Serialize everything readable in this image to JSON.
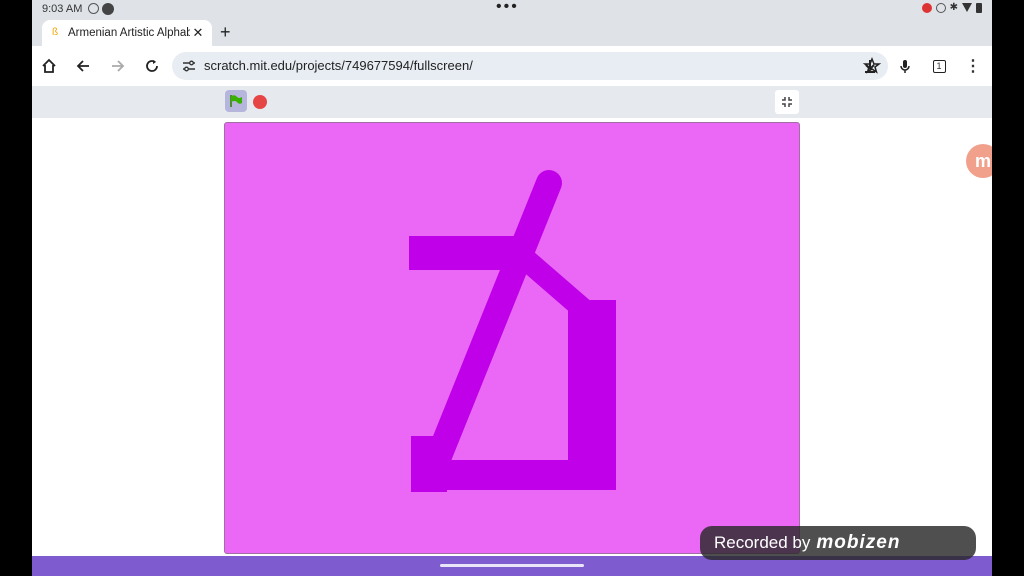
{
  "status": {
    "time": "9:03 AM"
  },
  "tab": {
    "title": "Armenian Artistic Alphabet"
  },
  "address": {
    "url": "scratch.mit.edu/projects/749677594/fullscreen/"
  },
  "stage": {
    "background": "#eb68f7",
    "glyph_color": "#c000e8"
  },
  "watermark": {
    "text": "Recorded by",
    "brand": "mobizen"
  },
  "colors": {
    "bottom_bar": "#7e5ccf",
    "stop": "#e64545",
    "flag": "#38b000"
  },
  "icons": {
    "home": "home-icon",
    "back": "back-arrow-icon",
    "forward": "forward-arrow-icon",
    "reload": "reload-icon",
    "download": "download-icon",
    "mic": "mic-icon",
    "tabs": "tab-count-icon",
    "menu": "more-vert-icon"
  },
  "toolbar": {
    "tab_count": "1"
  }
}
